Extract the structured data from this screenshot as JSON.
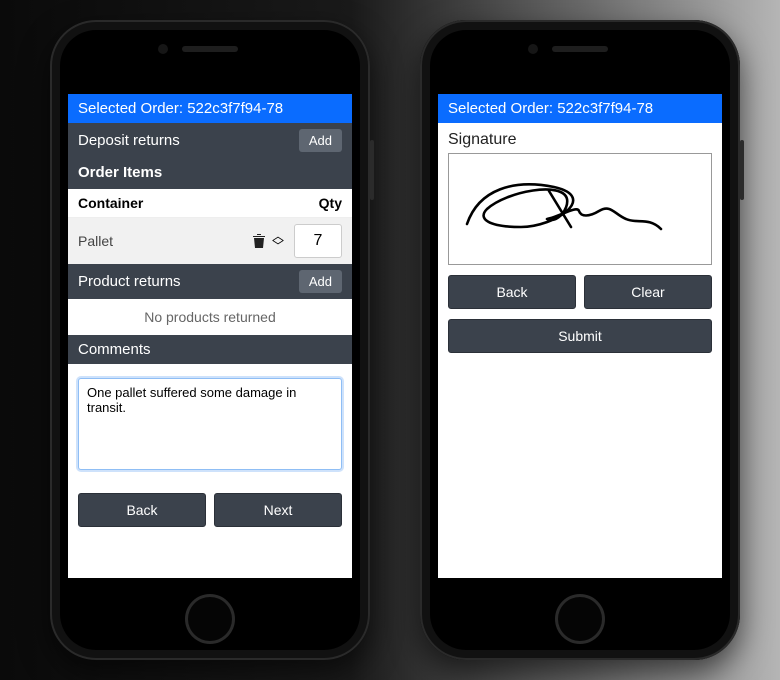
{
  "left": {
    "header": "Selected Order: 522c3f7f94-78",
    "sections": {
      "deposit_returns": {
        "title": "Deposit returns",
        "add_btn": "Add"
      },
      "order_items": {
        "title": "Order Items",
        "columns": {
          "container": "Container",
          "qty": "Qty"
        },
        "rows": [
          {
            "name": "Pallet",
            "qty": "7"
          }
        ]
      },
      "product_returns": {
        "title": "Product returns",
        "add_btn": "Add",
        "empty": "No products returned"
      },
      "comments": {
        "title": "Comments",
        "value": "One pallet suffered some damage in transit."
      }
    },
    "buttons": {
      "back": "Back",
      "next": "Next"
    }
  },
  "right": {
    "header": "Selected Order: 522c3f7f94-78",
    "signature_label": "Signature",
    "buttons": {
      "back": "Back",
      "clear": "Clear",
      "submit": "Submit"
    }
  }
}
